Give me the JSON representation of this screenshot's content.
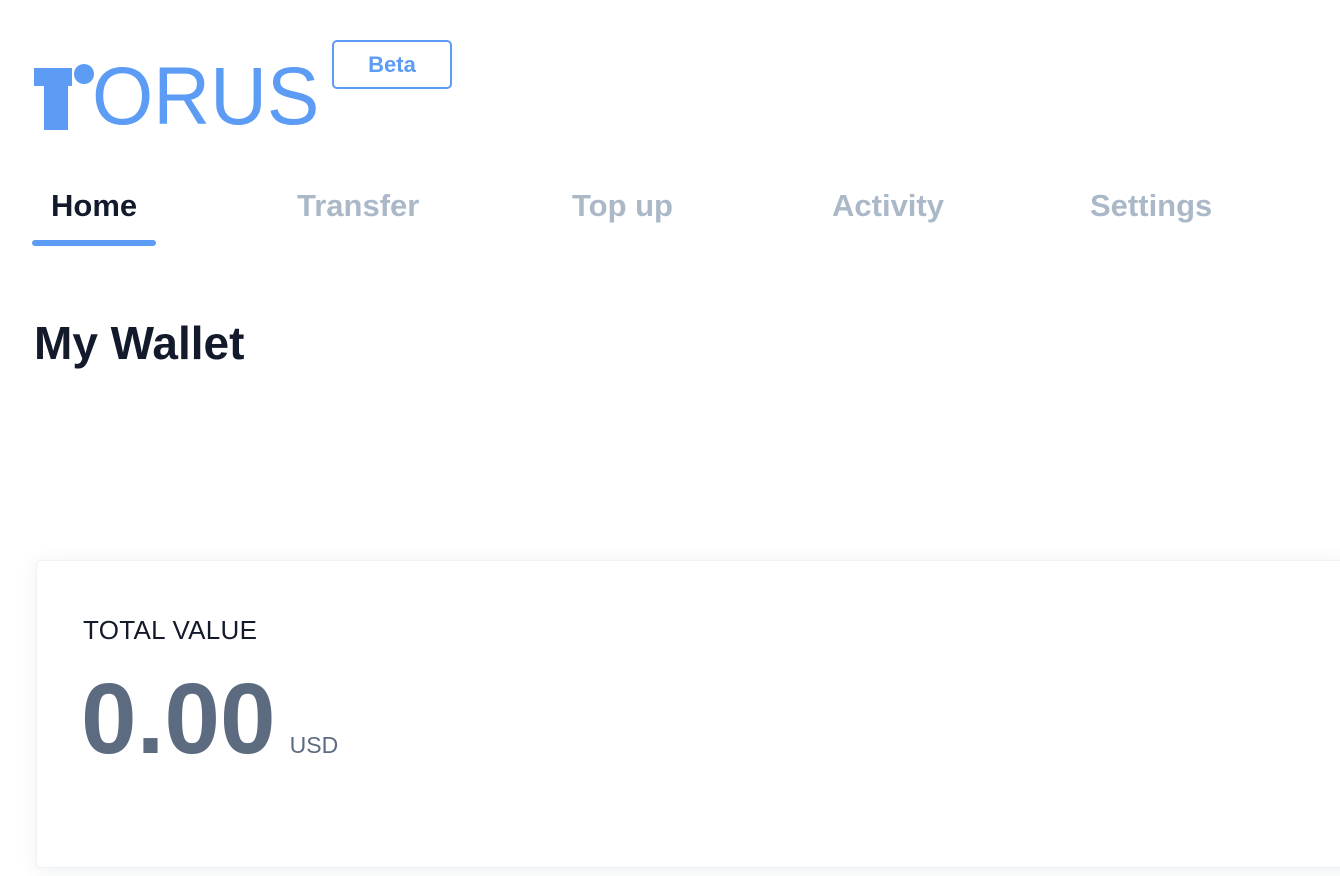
{
  "logo": {
    "text": "ORUS",
    "brand_color": "#5c9cf5",
    "mark_icon": "torus-t-logo-icon"
  },
  "badge": {
    "label": "Beta"
  },
  "nav": {
    "tabs": [
      {
        "label": "Home",
        "active": true
      },
      {
        "label": "Transfer",
        "active": false
      },
      {
        "label": "Top up",
        "active": false
      },
      {
        "label": "Activity",
        "active": false
      },
      {
        "label": "Settings",
        "active": false
      }
    ],
    "active_color": "#121a2b",
    "inactive_color": "#aab8c8",
    "underline_color": "#5c9cf5"
  },
  "main": {
    "title": "My Wallet",
    "card": {
      "label": "TOTAL VALUE",
      "amount": "0.00",
      "currency": "USD"
    }
  }
}
